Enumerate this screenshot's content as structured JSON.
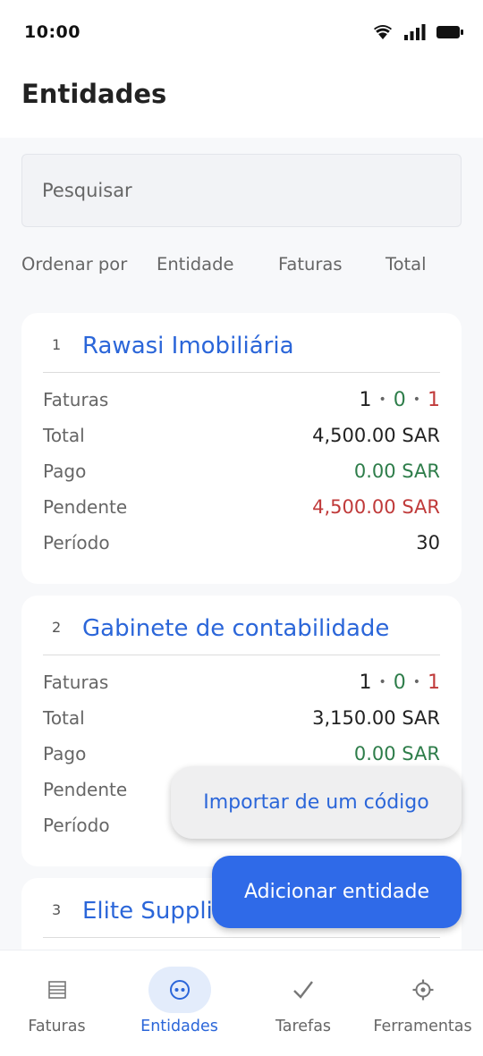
{
  "status_bar": {
    "time": "10:00",
    "icons": [
      "wifi-icon",
      "signal-icon",
      "battery-icon"
    ]
  },
  "header": {
    "title": "Entidades"
  },
  "search": {
    "placeholder": "Pesquisar"
  },
  "sort": {
    "label": "Ordenar por",
    "options": [
      "Entidade",
      "Faturas",
      "Total"
    ]
  },
  "entities": [
    {
      "number": "1",
      "name": "Rawasi Imobiliária",
      "faturas_label": "Faturas",
      "faturas_counts": [
        "1",
        "0",
        "1"
      ],
      "total_label": "Total",
      "total_value": "4,500.00 SAR",
      "pago_label": "Pago",
      "pago_value": "0.00 SAR",
      "pendente_label": "Pendente",
      "pendente_value": "4,500.00 SAR",
      "periodo_label": "Período",
      "periodo_value": "30"
    },
    {
      "number": "2",
      "name": "Gabinete de contabilidade",
      "faturas_label": "Faturas",
      "faturas_counts": [
        "1",
        "0",
        "1"
      ],
      "total_label": "Total",
      "total_value": "3,150.00 SAR",
      "pago_label": "Pago",
      "pago_value": "0.00 SAR",
      "pendente_label": "Pendente",
      "periodo_label": "Período"
    },
    {
      "number": "3",
      "name": "Elite Supplie"
    }
  ],
  "actions": {
    "import_label": "Importar de um código",
    "add_label": "Adicionar entidade"
  },
  "bottom_nav": {
    "items": [
      {
        "label": "Faturas",
        "icon": "list-icon"
      },
      {
        "label": "Entidades",
        "icon": "entities-icon",
        "active": true
      },
      {
        "label": "Tarefas",
        "icon": "check-icon"
      },
      {
        "label": "Ferramentas",
        "icon": "gear-icon"
      }
    ]
  },
  "colors": {
    "accent": "#2b66d9",
    "fab": "#2f6ae8",
    "positive": "#2e7d4a",
    "negative": "#c03a3a",
    "background": "#f7f8fa"
  }
}
